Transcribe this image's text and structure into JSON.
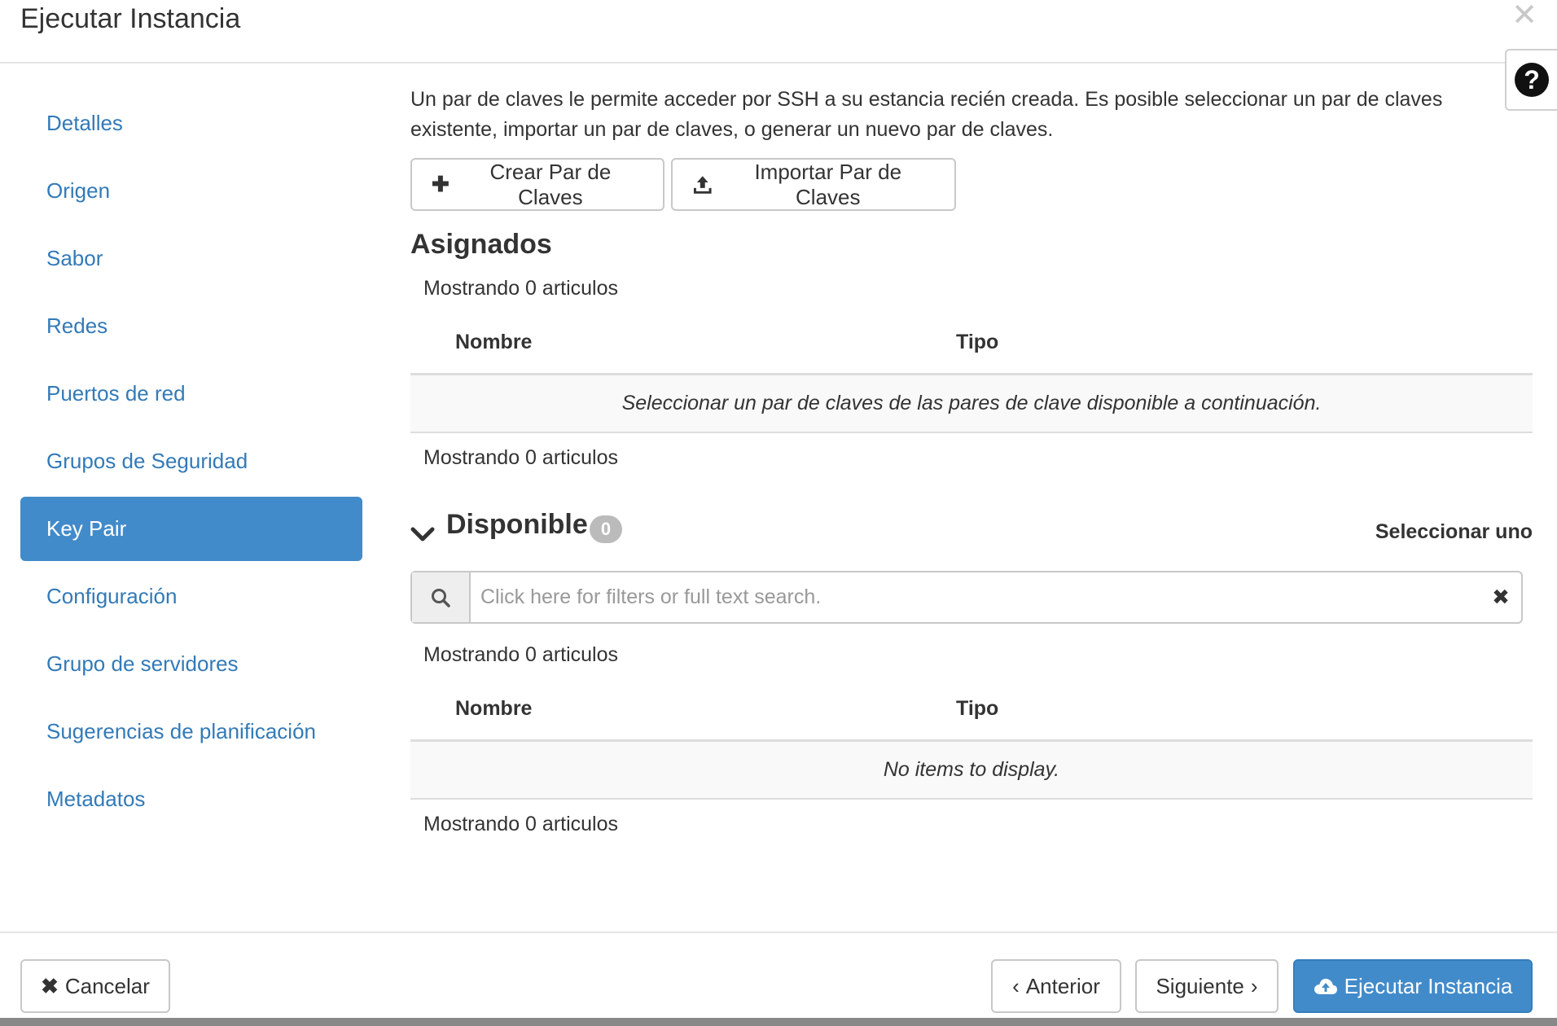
{
  "modal": {
    "title": "Ejecutar Instancia",
    "close_label": "✕",
    "help_label": "?"
  },
  "sidebar": {
    "items": [
      {
        "label": "Detalles"
      },
      {
        "label": "Origen"
      },
      {
        "label": "Sabor"
      },
      {
        "label": "Redes"
      },
      {
        "label": "Puertos de red"
      },
      {
        "label": "Grupos de Seguridad"
      },
      {
        "label": "Key Pair",
        "active": true
      },
      {
        "label": "Configuración"
      },
      {
        "label": "Grupo de servidores"
      },
      {
        "label": "Sugerencias de planificación"
      },
      {
        "label": "Metadatos"
      }
    ]
  },
  "main": {
    "intro": "Un par de claves le permite acceder por SSH a su estancia recién creada. Es posible seleccionar un par de claves existente, importar un par de claves, o generar un nuevo par de claves.",
    "create_button": "Crear Par de Claves",
    "import_button": "Importar Par de Claves",
    "assigned": {
      "title": "Asignados",
      "count_top": "Mostrando 0 articulos",
      "columns": [
        "Nombre",
        "Tipo"
      ],
      "empty_message": "Seleccionar un par de claves de las pares de clave disponible a continuación.",
      "count_bottom": "Mostrando 0 articulos"
    },
    "available": {
      "title": "Disponible",
      "badge": "0",
      "select_one": "Seleccionar uno",
      "search_placeholder": "Click here for filters or full text search.",
      "clear_label": "✖",
      "count_top": "Mostrando 0 articulos",
      "columns": [
        "Nombre",
        "Tipo"
      ],
      "empty_message": "No items to display.",
      "count_bottom": "Mostrando 0 articulos"
    }
  },
  "footer": {
    "cancel": "Cancelar",
    "previous": "Anterior",
    "next": "Siguiente",
    "launch": "Ejecutar Instancia"
  },
  "colors": {
    "link": "#337ab7",
    "primary": "#428bca"
  }
}
